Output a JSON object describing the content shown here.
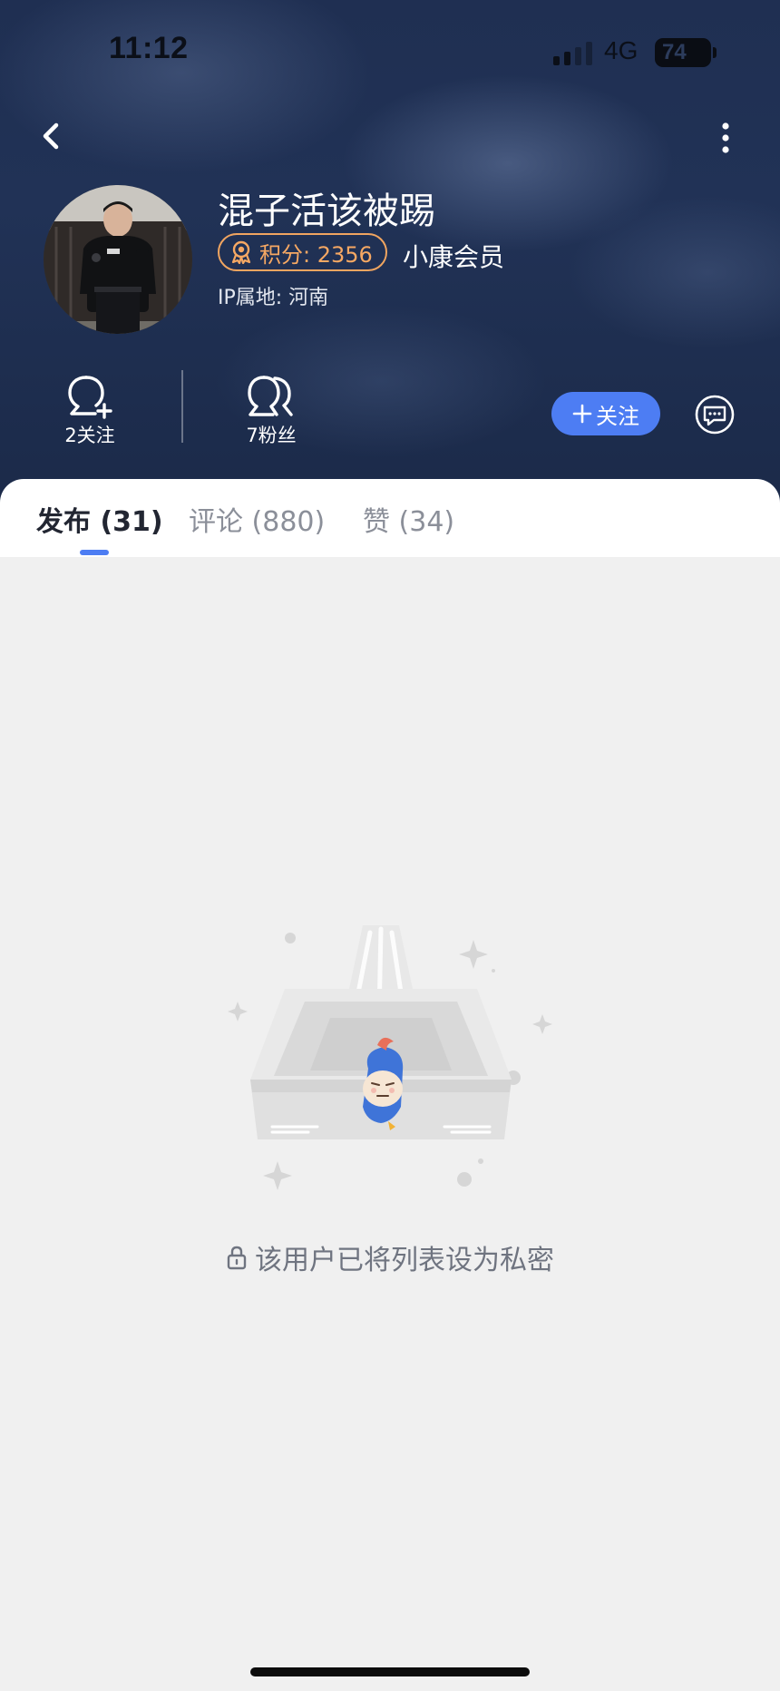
{
  "status_bar": {
    "time": "11:12",
    "network": "4G",
    "battery": "74"
  },
  "profile": {
    "username": "混子活该被踢",
    "points_label": "积分: 2356",
    "member_label": "小康会员",
    "ip_location": "IP属地: 河南"
  },
  "stats": {
    "following": "2关注",
    "followers": "7粉丝"
  },
  "actions": {
    "follow_label": "关注"
  },
  "tabs": [
    {
      "label": "发布 (31)",
      "active": true
    },
    {
      "label": "评论 (880)",
      "active": false
    },
    {
      "label": "赞 (34)",
      "active": false
    }
  ],
  "empty_state": {
    "message": "该用户已将列表设为私密"
  },
  "colors": {
    "accent": "#4d7df3",
    "points": "#f6a863",
    "header_bg": "#213256",
    "content_bg": "#f0f0f0"
  },
  "icons": {
    "back": "chevron-left-icon",
    "more": "more-vertical-icon",
    "medal": "medal-icon",
    "follow_user": "user-plus-icon",
    "fans": "users-icon",
    "plus": "plus-icon",
    "message": "chat-bubble-icon",
    "lock": "lock-icon"
  }
}
